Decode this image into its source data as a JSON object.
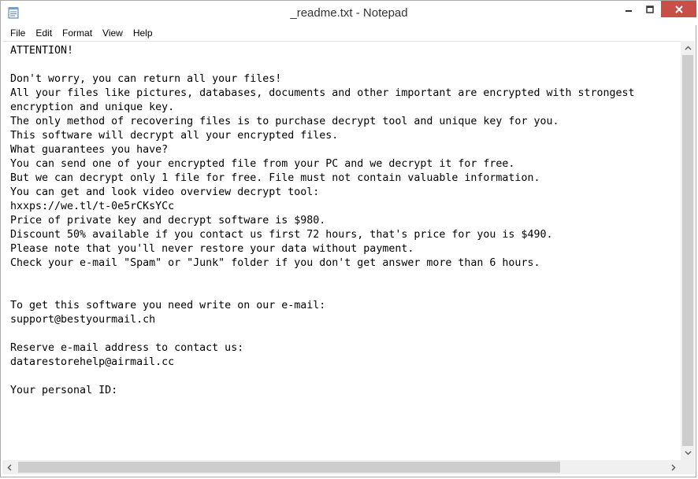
{
  "window": {
    "title": "_readme.txt - Notepad",
    "accent_close": "#c74f48"
  },
  "menu": [
    "File",
    "Edit",
    "Format",
    "View",
    "Help"
  ],
  "document": {
    "lines": [
      "ATTENTION!",
      "",
      "Don't worry, you can return all your files!",
      "All your files like pictures, databases, documents and other important are encrypted with strongest",
      "encryption and unique key.",
      "The only method of recovering files is to purchase decrypt tool and unique key for you.",
      "This software will decrypt all your encrypted files.",
      "What guarantees you have?",
      "You can send one of your encrypted file from your PC and we decrypt it for free.",
      "But we can decrypt only 1 file for free. File must not contain valuable information.",
      "You can get and look video overview decrypt tool:",
      "hxxps://we.tl/t-0e5rCKsYCc",
      "Price of private key and decrypt software is $980.",
      "Discount 50% available if you contact us first 72 hours, that's price for you is $490.",
      "Please note that you'll never restore your data without payment.",
      "Check your e-mail \"Spam\" or \"Junk\" folder if you don't get answer more than 6 hours.",
      "",
      "",
      "To get this software you need write on our e-mail:",
      "support@bestyourmail.ch",
      "",
      "Reserve e-mail address to contact us:",
      "datarestorehelp@airmail.cc",
      "",
      "Your personal ID:"
    ]
  }
}
